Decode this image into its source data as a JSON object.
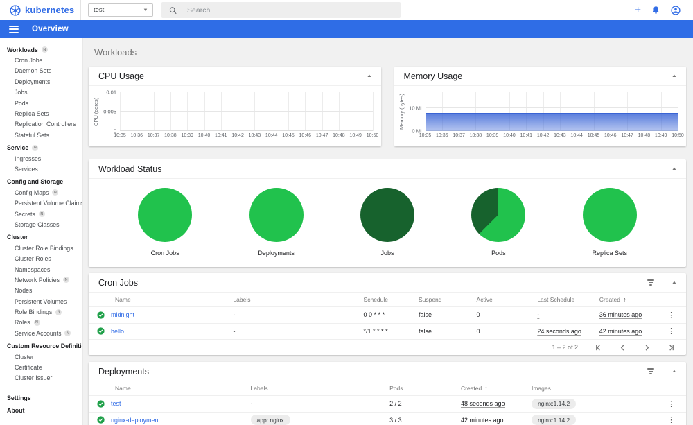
{
  "topbar": {
    "logo": "kubernetes",
    "namespace": {
      "value": "test"
    },
    "search_placeholder": "Search"
  },
  "toolbar": {
    "title": "Overview"
  },
  "sidebar": {
    "items": [
      {
        "label": "Workloads",
        "badge": "N"
      },
      {
        "label": "Cron Jobs",
        "sub": true
      },
      {
        "label": "Daemon Sets",
        "sub": true
      },
      {
        "label": "Deployments",
        "sub": true
      },
      {
        "label": "Jobs",
        "sub": true
      },
      {
        "label": "Pods",
        "sub": true
      },
      {
        "label": "Replica Sets",
        "sub": true
      },
      {
        "label": "Replication Controllers",
        "sub": true
      },
      {
        "label": "Stateful Sets",
        "sub": true
      },
      {
        "label": "Service",
        "badge": "N"
      },
      {
        "label": "Ingresses",
        "sub": true
      },
      {
        "label": "Services",
        "sub": true
      },
      {
        "label": "Config and Storage"
      },
      {
        "label": "Config Maps",
        "sub": true,
        "badge": "N"
      },
      {
        "label": "Persistent Volume Claims",
        "sub": true,
        "badge": "N"
      },
      {
        "label": "Secrets",
        "sub": true,
        "badge": "N"
      },
      {
        "label": "Storage Classes",
        "sub": true
      },
      {
        "label": "Cluster"
      },
      {
        "label": "Cluster Role Bindings",
        "sub": true
      },
      {
        "label": "Cluster Roles",
        "sub": true
      },
      {
        "label": "Namespaces",
        "sub": true
      },
      {
        "label": "Network Policies",
        "sub": true,
        "badge": "N"
      },
      {
        "label": "Nodes",
        "sub": true
      },
      {
        "label": "Persistent Volumes",
        "sub": true
      },
      {
        "label": "Role Bindings",
        "sub": true,
        "badge": "N"
      },
      {
        "label": "Roles",
        "sub": true,
        "badge": "N"
      },
      {
        "label": "Service Accounts",
        "sub": true,
        "badge": "N"
      },
      {
        "label": "Custom Resource Definitions"
      },
      {
        "label": "Cluster",
        "sub": true
      },
      {
        "label": "Certificate",
        "sub": true
      },
      {
        "label": "Cluster Issuer",
        "sub": true
      },
      {
        "label": "Settings",
        "divider_before": true
      },
      {
        "label": "About"
      }
    ]
  },
  "main": {
    "page_title": "Workloads"
  },
  "chart_data": [
    {
      "id": "cpu",
      "type": "area",
      "title": "CPU Usage",
      "ylabel": "CPU (cores)",
      "x": [
        "10:35",
        "10:36",
        "10:37",
        "10:38",
        "10:39",
        "10:40",
        "10:41",
        "10:42",
        "10:43",
        "10:44",
        "10:45",
        "10:46",
        "10:47",
        "10:48",
        "10:49",
        "10:50"
      ],
      "values": [
        0,
        0,
        0,
        0,
        0,
        0,
        0,
        0,
        0,
        0,
        0,
        0,
        0,
        0,
        0,
        0
      ],
      "ylim": [
        0,
        0.01
      ],
      "yticks": [
        {
          "label": "0",
          "value": 0
        },
        {
          "label": "0.005",
          "value": 0.005
        },
        {
          "label": "0.01",
          "value": 0.01
        }
      ],
      "grid": true,
      "series_color": "#3a64d4"
    },
    {
      "id": "memory",
      "type": "area",
      "title": "Memory Usage",
      "ylabel": "Memory (bytes)",
      "x": [
        "10:35",
        "10:36",
        "10:37",
        "10:38",
        "10:39",
        "10:40",
        "10:41",
        "10:42",
        "10:43",
        "10:44",
        "10:45",
        "10:46",
        "10:47",
        "10:48",
        "10:49",
        "10:50"
      ],
      "values": [
        7.8,
        7.8,
        7.8,
        7.8,
        7.8,
        7.8,
        7.8,
        7.8,
        7.8,
        7.8,
        7.8,
        7.8,
        7.8,
        7.8,
        7.8,
        7.8
      ],
      "unit": "Mi",
      "ylim": [
        0,
        17
      ],
      "yticks": [
        {
          "label": "0 Mi",
          "value": 0
        },
        {
          "label": "10 Mi",
          "value": 10
        }
      ],
      "grid": true,
      "series_color": "#3a64d4"
    },
    {
      "id": "workload_status",
      "type": "pie",
      "title": "Workload Status",
      "colors": {
        "green": "#21c24d",
        "dark_green": "#17622d"
      },
      "charts": [
        {
          "label": "Cron Jobs",
          "slices": [
            {
              "name": "ready",
              "fraction": 1,
              "color": "#21c24d"
            }
          ]
        },
        {
          "label": "Deployments",
          "slices": [
            {
              "name": "ready",
              "fraction": 1,
              "color": "#21c24d"
            }
          ]
        },
        {
          "label": "Jobs",
          "slices": [
            {
              "name": "succeeded",
              "fraction": 1,
              "color": "#17622d"
            }
          ]
        },
        {
          "label": "Pods",
          "slices": [
            {
              "name": "running",
              "fraction": 0.625,
              "color": "#21c24d"
            },
            {
              "name": "succeeded",
              "fraction": 0.375,
              "color": "#17622d"
            }
          ]
        },
        {
          "label": "Replica Sets",
          "slices": [
            {
              "name": "ready",
              "fraction": 1,
              "color": "#21c24d"
            }
          ]
        }
      ]
    }
  ],
  "tables": {
    "cron_jobs": {
      "title": "Cron Jobs",
      "columns": [
        "Name",
        "Labels",
        "Schedule",
        "Suspend",
        "Active",
        "Last Schedule",
        "Created"
      ],
      "sorted_column": "Created",
      "rows": [
        [
          "midnight",
          "-",
          "0 0 * * *",
          "false",
          "0",
          {
            "text": "-",
            "underline": true
          },
          {
            "text": "36 minutes ago",
            "underline": true
          }
        ],
        [
          "hello",
          "-",
          "*/1 * * * *",
          "false",
          "0",
          {
            "text": "24 seconds ago",
            "underline": true
          },
          {
            "text": "42 minutes ago",
            "underline": true
          }
        ]
      ],
      "pagination": {
        "range": "1 – 2 of 2"
      }
    },
    "deployments": {
      "title": "Deployments",
      "columns": [
        "Name",
        "Labels",
        "Pods",
        "Created",
        "Images"
      ],
      "sorted_column": "Created",
      "rows": [
        [
          "test",
          "-",
          "2 / 2",
          {
            "text": "48 seconds ago",
            "underline": true
          },
          {
            "text": "nginx:1.14.2",
            "chip": true
          }
        ],
        [
          "nginx-deployment",
          {
            "text": "app: nginx",
            "chip": true
          },
          "3 / 3",
          {
            "text": "42 minutes ago",
            "underline": true
          },
          {
            "text": "nginx:1.14.2",
            "chip": true
          }
        ]
      ]
    }
  }
}
